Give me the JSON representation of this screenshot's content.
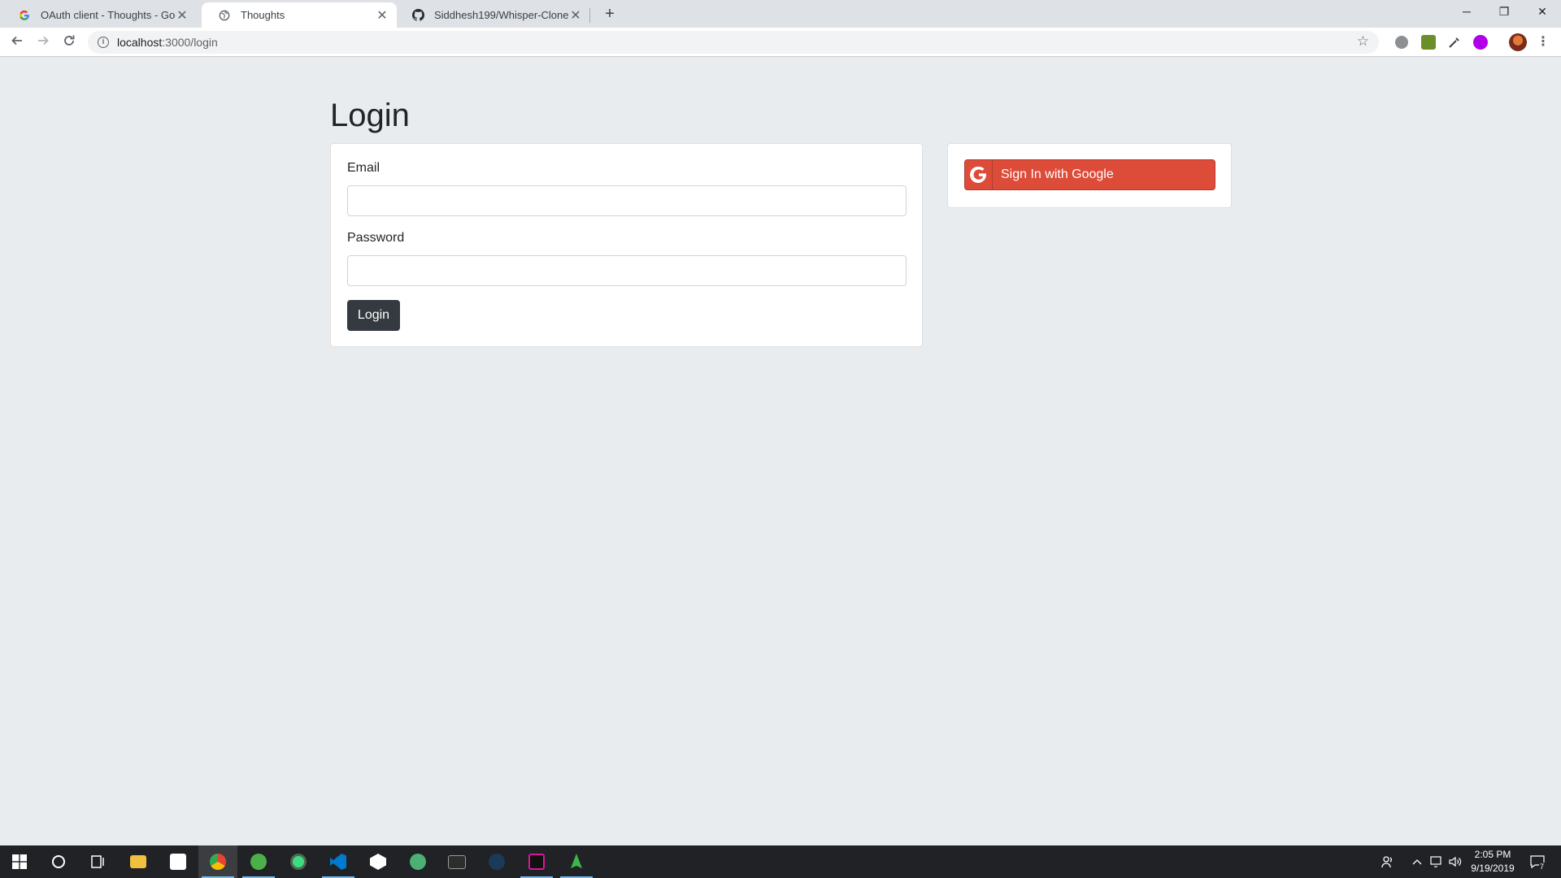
{
  "browser": {
    "tabs": [
      {
        "title": "OAuth client - Thoughts - Google",
        "close": "✕"
      },
      {
        "title": "Thoughts",
        "close": "✕"
      },
      {
        "title": "Siddhesh199/Whisper-Clone",
        "close": "✕"
      }
    ],
    "new_tab": "+",
    "url_host": "localhost",
    "url_path": ":3000/login",
    "window_controls": {
      "minimize": "─",
      "restore": "❐",
      "close": "✕"
    }
  },
  "page": {
    "title": "Login",
    "form": {
      "email_label": "Email",
      "email_value": "",
      "password_label": "Password",
      "password_value": "",
      "submit_label": "Login"
    },
    "google": {
      "label": "Sign In with Google",
      "color": "#dd4b39"
    }
  },
  "taskbar": {
    "icons": [
      "windows-start-icon",
      "cortana-search-icon",
      "task-view-icon",
      "file-explorer-icon",
      "microsoft-store-icon",
      "chrome-icon",
      "utorrent-icon",
      "android-studio-icon",
      "vscode-icon",
      "unity-icon",
      "app-green-icon",
      "terminal-window-icon",
      "steam-icon",
      "hyper-terminal-icon",
      "robo3t-icon"
    ],
    "time": "2:05 PM",
    "date": "9/19/2019",
    "notification_count": "7"
  },
  "colors": {
    "page_bg": "#e9ecef",
    "login_button": "#343a40",
    "google_button": "#dd4b39"
  }
}
